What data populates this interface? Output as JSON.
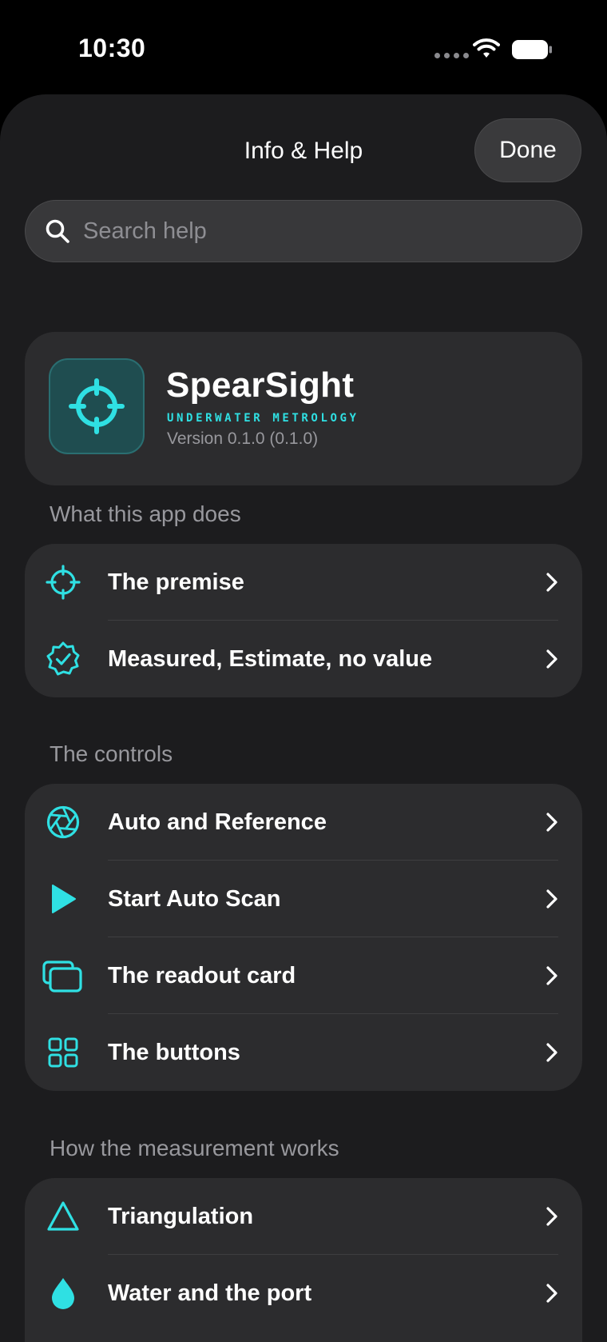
{
  "status_bar": {
    "time": "10:30"
  },
  "header": {
    "title": "Info & Help",
    "done_label": "Done"
  },
  "search": {
    "placeholder": "Search help",
    "value": ""
  },
  "app": {
    "name": "SpearSight",
    "tagline": "UNDERWATER METROLOGY",
    "version": "Version 0.1.0 (0.1.0)",
    "icon": "crosshair-icon"
  },
  "sections": [
    {
      "header": "What this app does",
      "items": [
        {
          "label": "The premise",
          "icon": "crosshair-icon"
        },
        {
          "label": "Measured, Estimate, no value",
          "icon": "verified-badge-icon"
        }
      ]
    },
    {
      "header": "The controls",
      "items": [
        {
          "label": "Auto and Reference",
          "icon": "aperture-icon"
        },
        {
          "label": "Start Auto Scan",
          "icon": "play-icon"
        },
        {
          "label": "The readout card",
          "icon": "stacked-cards-icon"
        },
        {
          "label": "The buttons",
          "icon": "grid-icon"
        }
      ]
    },
    {
      "header": "How the measurement works",
      "items": [
        {
          "label": "Triangulation",
          "icon": "triangle-icon"
        },
        {
          "label": "Water and the port",
          "icon": "water-drop-icon"
        }
      ]
    }
  ],
  "colors": {
    "accent": "#2fe0e3",
    "background": "#000000",
    "sheet": "#1c1c1e",
    "card": "#2c2c2e",
    "secondary_text": "#98989d"
  }
}
